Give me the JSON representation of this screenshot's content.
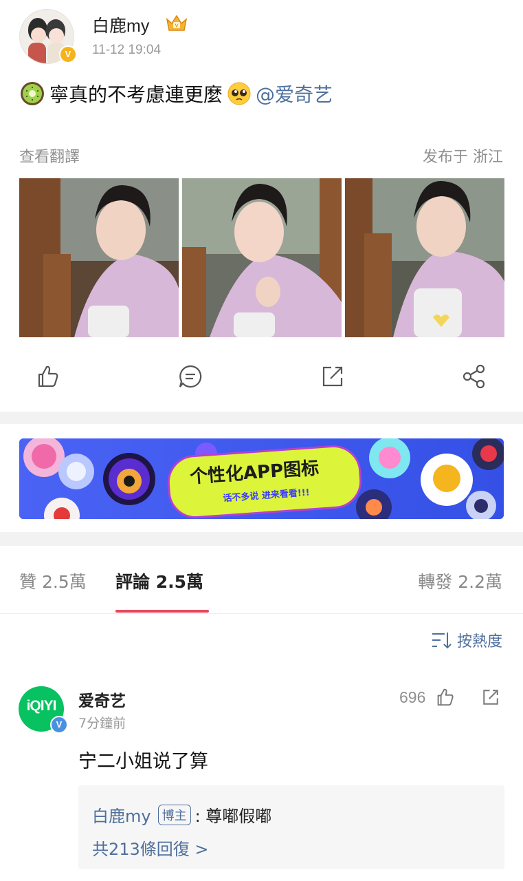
{
  "post": {
    "username": "白鹿my",
    "time": "11-12 19:04",
    "text_main": "寧真的不考慮連更麼",
    "mention": "@爱奇艺",
    "translate_label": "查看翻譯",
    "location": "发布于 浙江",
    "verified_badge": "V"
  },
  "actions": {
    "like_icon": "thumb-up-icon",
    "comment_icon": "comment-icon",
    "repost_icon": "repost-icon",
    "share_icon": "share-icon"
  },
  "banner": {
    "title": "个性化APP图标",
    "subtitle": "话不多说 进来看看!!!",
    "colors": {
      "background": "#3f5bf0",
      "pill": "#dcf53a",
      "pill_border": "#b83fd0"
    }
  },
  "tabs": {
    "likes": "贊 2.5萬",
    "comments": "評論 2.5萬",
    "reposts": "轉發 2.2萬",
    "accent": "#e8485c"
  },
  "sort": {
    "label": "按熱度"
  },
  "comment": {
    "avatar_text": "iQIYI",
    "verified_badge": "V",
    "author": "爱奇艺",
    "time": "7分鐘前",
    "likes": "696",
    "text": "宁二小姐说了算",
    "reply": {
      "user": "白鹿my",
      "tag": "博主",
      "text": ": 尊嘟假嘟",
      "count": "共213條回復 >"
    }
  }
}
